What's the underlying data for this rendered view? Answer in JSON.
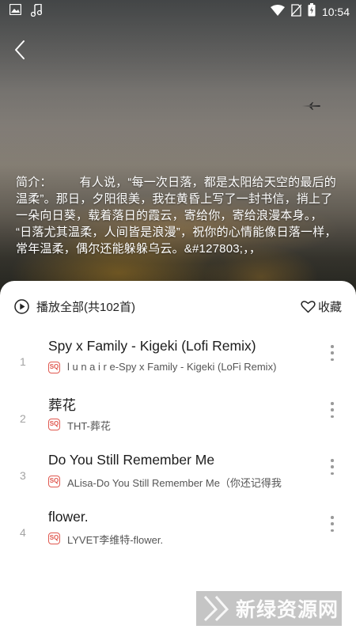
{
  "status_bar": {
    "time": "10:54",
    "left_icons": [
      "image-icon",
      "music-note-icon"
    ],
    "right_icons": [
      "wifi-icon",
      "no-sim-icon",
      "battery-icon"
    ]
  },
  "header": {
    "back_icon": "chevron-left-icon"
  },
  "intro": {
    "text": "简介：        有人说，“每一次日落，都是太阳给天空的最后的温柔”。那日，夕阳很美，我在黄昏上写了一封书信，捎上了一朵向日葵，载着落日的霞云，寄给你，寄给浪漫本身。，        “日落尤其温柔，人间皆是浪漫”，祝你的心情能像日落一样，常年温柔，偶尔还能躲躲乌云。&#127803;，，"
  },
  "toolbar": {
    "play_all_label": "播放全部(共102首)",
    "collect_label": "收藏"
  },
  "songs": [
    {
      "index": "1",
      "title": "Spy x Family - Kigeki (Lofi Remix)",
      "badge": "SQ",
      "subtitle": "l u n a i r e-Spy x Family - Kigeki (LoFi Remix)"
    },
    {
      "index": "2",
      "title": "葬花",
      "badge": "SQ",
      "subtitle": "THT-葬花"
    },
    {
      "index": "3",
      "title": "Do You Still Remember Me",
      "badge": "SQ",
      "subtitle": "ALisa-Do You Still Remember Me（你还记得我"
    },
    {
      "index": "4",
      "title": "flower.",
      "badge": "SQ",
      "subtitle": "LYVET李维特-flower."
    }
  ],
  "watermark": {
    "text": "新绿资源网"
  },
  "colors": {
    "accent_red": "#e0584f",
    "index_gray": "#a3a3a3"
  }
}
